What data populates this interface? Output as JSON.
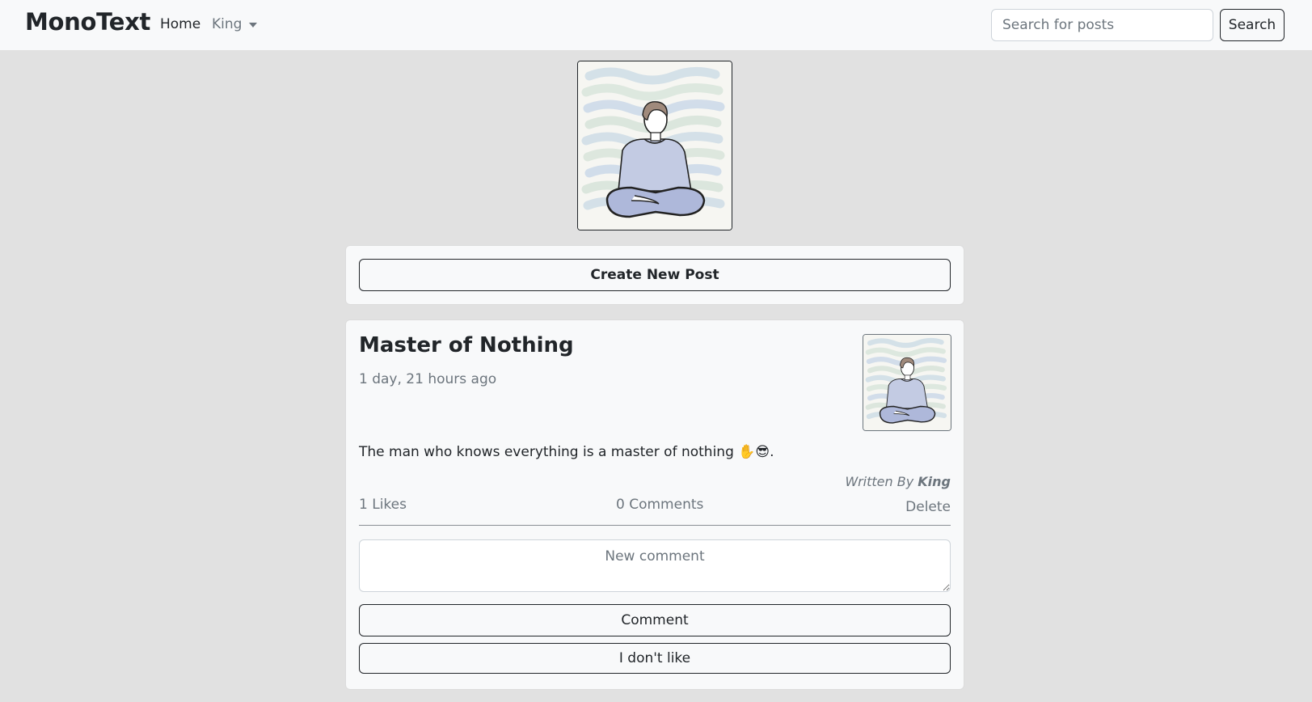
{
  "navbar": {
    "brand": "MonoText",
    "home_label": "Home",
    "user_menu_label": "King",
    "search": {
      "placeholder": "Search for posts",
      "value": "",
      "button_label": "Search"
    }
  },
  "profile": {
    "avatar_icon": "meditating-person-icon"
  },
  "create_post": {
    "button_label": "Create New Post"
  },
  "post": {
    "title": "Master of Nothing",
    "time_ago": "1 day, 21 hours ago",
    "body": "The man who knows everything is a master of nothing ✋😎.",
    "written_by_prefix": "Written By",
    "author": "King",
    "likes": "1 Likes",
    "comments": "0 Comments",
    "delete_label": "Delete",
    "comment_placeholder": "New comment",
    "comment_button_label": "Comment",
    "dislike_button_label": "I don't like"
  },
  "colors": {
    "page_bg": "#e1e1e1",
    "navbar_bg": "#f8f9fa",
    "card_bg": "#f8f9fa",
    "muted_text": "#6c757d",
    "dark_text": "#212529"
  }
}
